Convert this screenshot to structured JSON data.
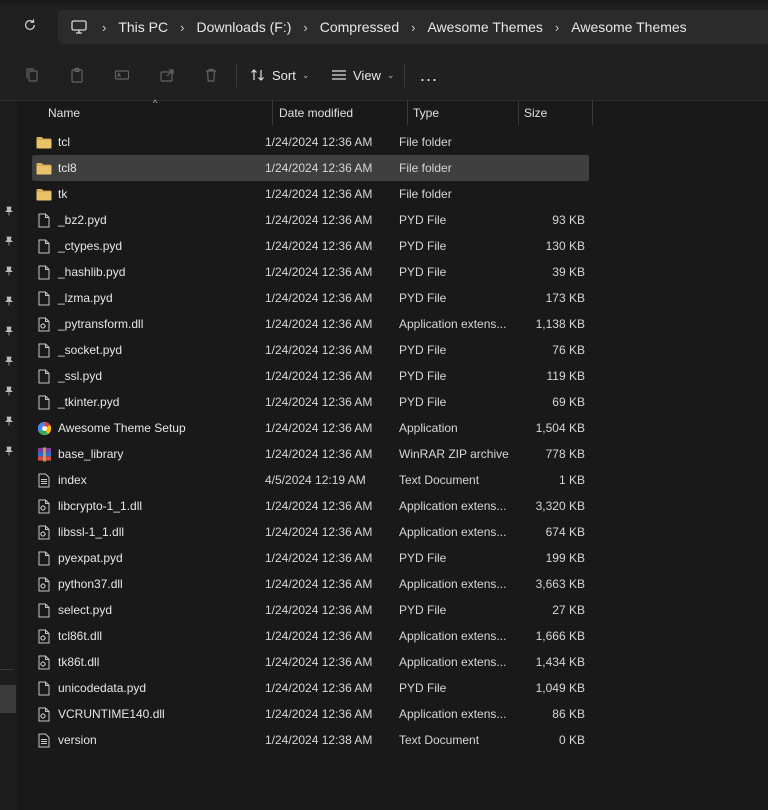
{
  "address_bar": {
    "crumbs": [
      "This PC",
      "Downloads (F:)",
      "Compressed",
      "Awesome Themes",
      "Awesome Themes"
    ]
  },
  "toolbar": {
    "sort_label": "Sort",
    "view_label": "View",
    "more_label": "..."
  },
  "columns": {
    "name": "Name",
    "date": "Date modified",
    "type": "Type",
    "size": "Size"
  },
  "files": [
    {
      "name": "tcl",
      "date": "1/24/2024 12:36 AM",
      "type": "File folder",
      "size": "",
      "icon": "folder-icon"
    },
    {
      "name": "tcl8",
      "date": "1/24/2024 12:36 AM",
      "type": "File folder",
      "size": "",
      "icon": "folder-icon",
      "selected": true
    },
    {
      "name": "tk",
      "date": "1/24/2024 12:36 AM",
      "type": "File folder",
      "size": "",
      "icon": "folder-icon"
    },
    {
      "name": "_bz2.pyd",
      "date": "1/24/2024 12:36 AM",
      "type": "PYD File",
      "size": "93 KB",
      "icon": "file-icon"
    },
    {
      "name": "_ctypes.pyd",
      "date": "1/24/2024 12:36 AM",
      "type": "PYD File",
      "size": "130 KB",
      "icon": "file-icon"
    },
    {
      "name": "_hashlib.pyd",
      "date": "1/24/2024 12:36 AM",
      "type": "PYD File",
      "size": "39 KB",
      "icon": "file-icon"
    },
    {
      "name": "_lzma.pyd",
      "date": "1/24/2024 12:36 AM",
      "type": "PYD File",
      "size": "173 KB",
      "icon": "file-icon"
    },
    {
      "name": "_pytransform.dll",
      "date": "1/24/2024 12:36 AM",
      "type": "Application extens...",
      "size": "1,138 KB",
      "icon": "dll-icon"
    },
    {
      "name": "_socket.pyd",
      "date": "1/24/2024 12:36 AM",
      "type": "PYD File",
      "size": "76 KB",
      "icon": "file-icon"
    },
    {
      "name": "_ssl.pyd",
      "date": "1/24/2024 12:36 AM",
      "type": "PYD File",
      "size": "119 KB",
      "icon": "file-icon"
    },
    {
      "name": "_tkinter.pyd",
      "date": "1/24/2024 12:36 AM",
      "type": "PYD File",
      "size": "69 KB",
      "icon": "file-icon"
    },
    {
      "name": "Awesome Theme Setup",
      "date": "1/24/2024 12:36 AM",
      "type": "Application",
      "size": "1,504 KB",
      "icon": "app-icon"
    },
    {
      "name": "base_library",
      "date": "1/24/2024 12:36 AM",
      "type": "WinRAR ZIP archive",
      "size": "778 KB",
      "icon": "archive-icon"
    },
    {
      "name": "index",
      "date": "4/5/2024 12:19 AM",
      "type": "Text Document",
      "size": "1 KB",
      "icon": "text-icon"
    },
    {
      "name": "libcrypto-1_1.dll",
      "date": "1/24/2024 12:36 AM",
      "type": "Application extens...",
      "size": "3,320 KB",
      "icon": "dll-icon"
    },
    {
      "name": "libssl-1_1.dll",
      "date": "1/24/2024 12:36 AM",
      "type": "Application extens...",
      "size": "674 KB",
      "icon": "dll-icon"
    },
    {
      "name": "pyexpat.pyd",
      "date": "1/24/2024 12:36 AM",
      "type": "PYD File",
      "size": "199 KB",
      "icon": "file-icon"
    },
    {
      "name": "python37.dll",
      "date": "1/24/2024 12:36 AM",
      "type": "Application extens...",
      "size": "3,663 KB",
      "icon": "dll-icon"
    },
    {
      "name": "select.pyd",
      "date": "1/24/2024 12:36 AM",
      "type": "PYD File",
      "size": "27 KB",
      "icon": "file-icon"
    },
    {
      "name": "tcl86t.dll",
      "date": "1/24/2024 12:36 AM",
      "type": "Application extens...",
      "size": "1,666 KB",
      "icon": "dll-icon"
    },
    {
      "name": "tk86t.dll",
      "date": "1/24/2024 12:36 AM",
      "type": "Application extens...",
      "size": "1,434 KB",
      "icon": "dll-icon"
    },
    {
      "name": "unicodedata.pyd",
      "date": "1/24/2024 12:36 AM",
      "type": "PYD File",
      "size": "1,049 KB",
      "icon": "file-icon"
    },
    {
      "name": "VCRUNTIME140.dll",
      "date": "1/24/2024 12:36 AM",
      "type": "Application extens...",
      "size": "86 KB",
      "icon": "dll-icon"
    },
    {
      "name": "version",
      "date": "1/24/2024 12:38 AM",
      "type": "Text Document",
      "size": "0 KB",
      "icon": "text-icon"
    }
  ],
  "colors": {
    "background": "#191919",
    "chrome": "#202020",
    "selection": "#3f3f3f",
    "folder": "#dcb05a"
  }
}
